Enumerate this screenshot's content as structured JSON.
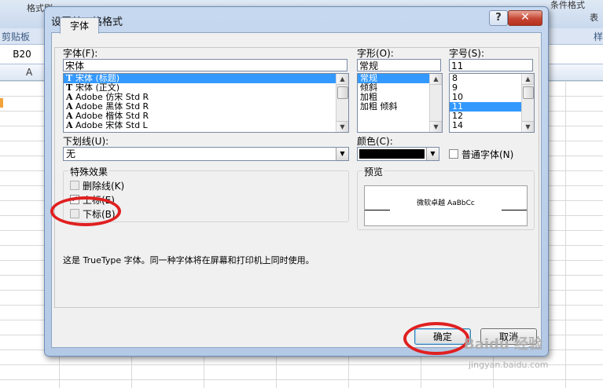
{
  "excel": {
    "ribbon_left_text": "格式刷",
    "ribbon_right_text": "条件格式",
    "ribbon_right_text2": "表",
    "group_label_clipboard": "剪贴板",
    "group_label_right": "样",
    "name_box": "B20",
    "column_header_a": "A"
  },
  "dialog": {
    "title": "设置单元格格式",
    "help_label": "?",
    "close_label": "✕",
    "tab_font": "字体",
    "font_label": "字体(F):",
    "font_value": "宋体",
    "font_list": [
      {
        "icon": "T",
        "name": "宋体 (标题)",
        "selected": true
      },
      {
        "icon": "T",
        "name": "宋体 (正文)",
        "selected": false
      },
      {
        "icon": "A",
        "name": "Adobe 仿宋 Std R",
        "selected": false
      },
      {
        "icon": "A",
        "name": "Adobe 黑体 Std R",
        "selected": false
      },
      {
        "icon": "A",
        "name": "Adobe 楷体 Std R",
        "selected": false
      },
      {
        "icon": "A",
        "name": "Adobe 宋体 Std L",
        "selected": false
      }
    ],
    "style_label": "字形(O):",
    "style_value": "常规",
    "style_list": [
      "常规",
      "倾斜",
      "加粗",
      "加粗 倾斜"
    ],
    "style_selected_index": 0,
    "size_label": "字号(S):",
    "size_value": "11",
    "size_list": [
      "8",
      "9",
      "10",
      "11",
      "12",
      "14"
    ],
    "size_selected_index": 3,
    "underline_label": "下划线(U):",
    "underline_value": "无",
    "color_label": "颜色(C):",
    "color_value": "#000000",
    "normal_font_label": "普通字体(N)",
    "normal_font_checked": false,
    "effects_label": "特殊效果",
    "strikethrough_label": "删除线(K)",
    "strikethrough_checked": false,
    "superscript_label": "上标(E)",
    "superscript_checked": true,
    "subscript_label": "下标(B)",
    "subscript_checked": false,
    "preview_label": "预览",
    "preview_text": "微软卓越  AaBbCc",
    "info_text": "这是 TrueType 字体。同一种字体将在屏幕和打印机上同时使用。",
    "ok_label": "确定",
    "cancel_label": "取消"
  },
  "watermark": {
    "brand": "Baidu 经验",
    "url": "jingyan.baidu.com"
  },
  "colors": {
    "selection": "#3399ff",
    "annotation_red": "#e02020"
  }
}
